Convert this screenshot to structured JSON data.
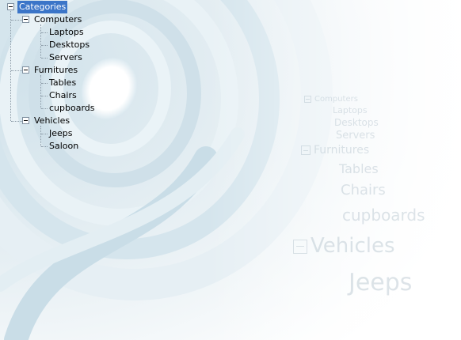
{
  "tree": {
    "root": {
      "label": "Categories",
      "selected": true,
      "expanded": true
    },
    "computers": {
      "label": "Computers",
      "children": {
        "laptops": "Laptops",
        "desktops": "Desktops",
        "servers": "Servers"
      }
    },
    "furnitures": {
      "label": "Furnitures",
      "children": {
        "tables": "Tables",
        "chairs": "Chairs",
        "cupboards": "cupboards"
      }
    },
    "vehicles": {
      "label": "Vehicles",
      "children": {
        "jeeps": "Jeeps",
        "saloon": "Saloon"
      }
    }
  },
  "colors": {
    "selection": "#3b75c8",
    "background": "#f4f8fa",
    "accent_swirl": "#d6e6ee"
  }
}
